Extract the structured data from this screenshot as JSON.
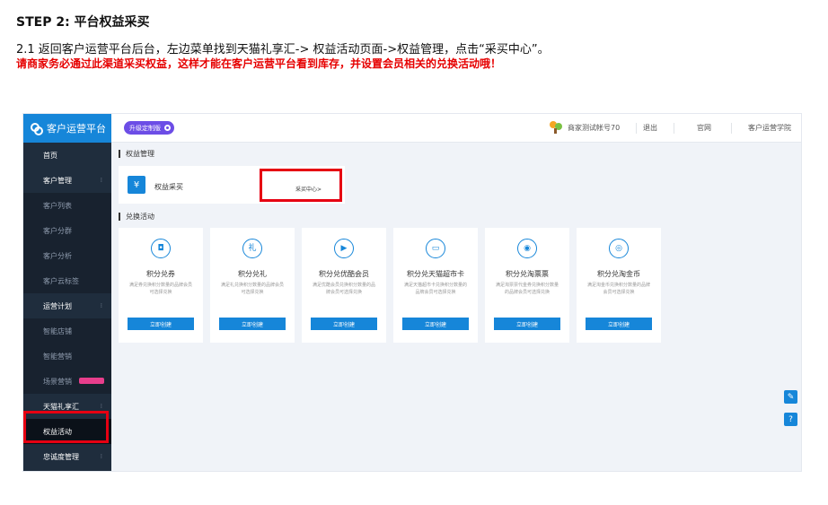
{
  "doc": {
    "step_title": "STEP 2: 平台权益采买",
    "line1": "2.1 返回客户运营平台后台，左边菜单找到天猫礼享汇-> 权益活动页面->权益管理，点击“采买中心”。",
    "line2": "请商家务必通过此渠道采买权益，这样才能在客户运营平台看到库存，并设置会员相关的兑换活动哦！"
  },
  "brand": {
    "title": "客户运营平台",
    "icon": "flower-logo-icon"
  },
  "sidebar": {
    "items": [
      {
        "label": "首页"
      },
      {
        "label": "客户管理",
        "expandable": true
      },
      {
        "label": "客户列表",
        "sub": true
      },
      {
        "label": "客户分群",
        "sub": true
      },
      {
        "label": "客户分析",
        "sub": true
      },
      {
        "label": "客户云标签",
        "sub": true
      },
      {
        "label": "运营计划",
        "expandable": true
      },
      {
        "label": "智能店铺",
        "sub": true
      },
      {
        "label": "智能营销",
        "sub": true
      },
      {
        "label": "场景营销",
        "sub": true,
        "badge": true
      },
      {
        "label": "天猫礼享汇",
        "expandable": true
      },
      {
        "label": "权益活动",
        "active": true
      },
      {
        "label": "忠诚度管理",
        "expandable": true
      }
    ]
  },
  "topbar": {
    "upgrade_label": "升级定制版",
    "account": "商家测试帐号70",
    "logout": "退出",
    "official": "官网",
    "academy": "客户运营学院"
  },
  "rights": {
    "section_title": "权益管理",
    "yen_icon": "¥",
    "card_label": "权益采买",
    "center_link": "采买中心>"
  },
  "exchange": {
    "section_title": "兑换活动",
    "cards": [
      {
        "title": "积分兑券",
        "desc": "满足券兑换积分数量的品牌会员可选择兑换",
        "button": "立即创建",
        "icon": "ticket-icon",
        "glyph": "◘"
      },
      {
        "title": "积分兑礼",
        "desc": "满足礼兑换积分数量的品牌会员可选择兑换",
        "button": "立即创建",
        "icon": "gift-icon",
        "glyph": "礼"
      },
      {
        "title": "积分兑优酷会员",
        "desc": "满足优酷会员兑换积分数量的品牌会员可选择兑换",
        "button": "立即创建",
        "icon": "youku-icon",
        "glyph": "▶"
      },
      {
        "title": "积分兑天猫超市卡",
        "desc": "满足天猫超市卡兑换积分数量的品牌会员可选择兑换",
        "button": "立即创建",
        "icon": "card-icon",
        "glyph": "▭"
      },
      {
        "title": "积分兑淘票票",
        "desc": "满足淘票票代金券兑换积分数量的品牌会员可选择兑换",
        "button": "立即创建",
        "icon": "movie-ticket-icon",
        "glyph": "◉"
      },
      {
        "title": "积分兑淘金币",
        "desc": "满足淘金币兑换积分数量的品牌会员可选择兑换",
        "button": "立即创建",
        "icon": "coin-icon",
        "glyph": "◎"
      }
    ]
  },
  "floating": {
    "edit_icon": "✎",
    "help_icon": "?"
  },
  "colors": {
    "accent": "#1686d9",
    "sidebar": "#1f2d3d",
    "highlight_red": "#e60012",
    "upgrade_purple": "#6c4de6"
  }
}
